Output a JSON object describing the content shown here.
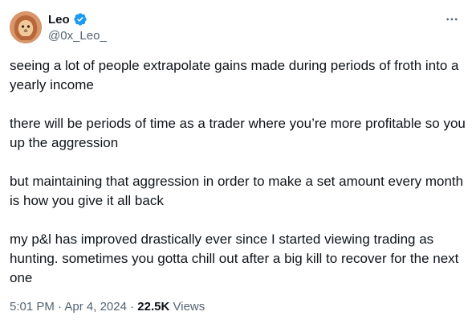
{
  "author": {
    "name": "Leo",
    "handle": "@0x_Leo_",
    "verified": true,
    "verified_color": "#1d9bf0"
  },
  "tweet": {
    "paragraphs": [
      "seeing a lot of people extrapolate gains made during periods of froth into a yearly income",
      "there will be periods of time as a trader where you’re more profitable so you up the aggression",
      "but maintaining that aggression in order to make a set amount every month is how you give it all back",
      "my p&l has improved drastically ever since I started viewing trading as hunting. sometimes you gotta chill out after a big kill to recover for the next one"
    ]
  },
  "meta": {
    "time": "5:01 PM",
    "separator": "·",
    "date": "Apr 4, 2024",
    "views_count": "22.5K",
    "views_label": "Views"
  },
  "icons": {
    "more": "more-icon",
    "verified": "verified-badge-icon"
  }
}
